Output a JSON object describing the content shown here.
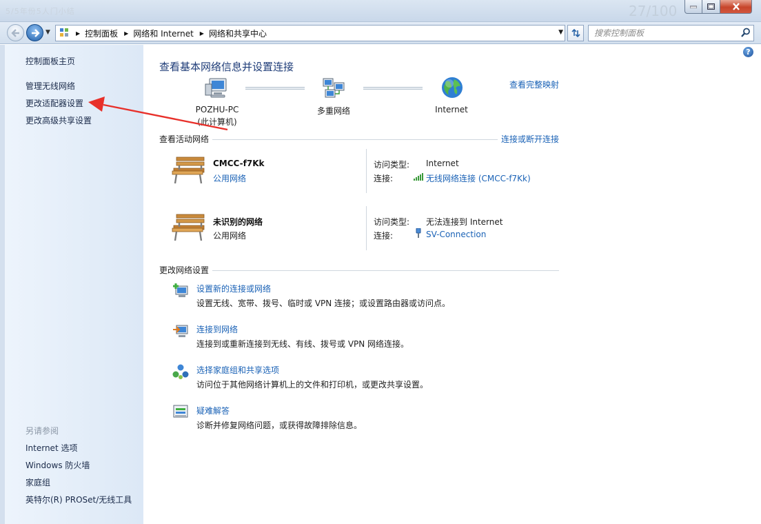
{
  "titlebar": {
    "ghost_title": "5/5年份5人门小结",
    "ghost_number": "27/100"
  },
  "address": {
    "breadcrumbs": [
      "控制面板",
      "网络和 Internet",
      "网络和共享中心"
    ],
    "search_placeholder": "搜索控制面板"
  },
  "sidebar": {
    "home": "控制面板主页",
    "tasks": [
      "管理无线网络",
      "更改适配器设置",
      "更改高级共享设置"
    ],
    "see_also_title": "另请参阅",
    "see_also": [
      "Internet 选项",
      "Windows 防火墙",
      "家庭组",
      "英特尔(R) PROSet/无线工具"
    ]
  },
  "main": {
    "title": "查看基本网络信息并设置连接",
    "map_link": "查看完整映射",
    "map_nodes": [
      {
        "label": "POZHU-PC",
        "sublabel": "(此计算机)",
        "icon": "computer-icon"
      },
      {
        "label": "多重网络",
        "icon": "multiple-networks-icon"
      },
      {
        "label": "Internet",
        "icon": "globe-icon"
      }
    ],
    "active_networks_title": "查看活动网络",
    "connect_link": "连接或断开连接",
    "active_networks": [
      {
        "name": "CMCC-f7Kk",
        "type": "公用网络",
        "type_is_link": true,
        "access_label": "访问类型:",
        "access_value": "Internet",
        "conn_label": "连接:",
        "conn_value": "无线网络连接 (CMCC-f7Kk)",
        "conn_icon": "wifi-signal-icon"
      },
      {
        "name": "未识别的网络",
        "type": "公用网络",
        "type_is_link": false,
        "access_label": "访问类型:",
        "access_value": "无法连接到 Internet",
        "conn_label": "连接:",
        "conn_value": "SV-Connection",
        "conn_icon": "usb-plug-icon"
      }
    ],
    "change_settings_title": "更改网络设置",
    "tasks": [
      {
        "title": "设置新的连接或网络",
        "desc": "设置无线、宽带、拨号、临时或 VPN 连接；或设置路由器或访问点。",
        "icon": "new-connection-icon"
      },
      {
        "title": "连接到网络",
        "desc": "连接到或重新连接到无线、有线、拨号或 VPN 网络连接。",
        "icon": "connect-network-icon"
      },
      {
        "title": "选择家庭组和共享选项",
        "desc": "访问位于其他网络计算机上的文件和打印机，或更改共享设置。",
        "icon": "homegroup-icon"
      },
      {
        "title": "疑难解答",
        "desc": "诊断并修复网络问题，或获得故障排除信息。",
        "icon": "troubleshoot-icon"
      }
    ]
  },
  "colors": {
    "link": "#1a62b6",
    "title": "#1e3c78",
    "annotation_arrow": "#e8302a"
  }
}
